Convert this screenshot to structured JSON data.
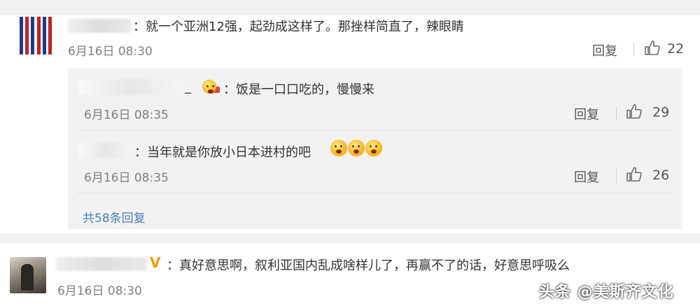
{
  "comments": [
    {
      "text": "：就一个亚洲12强，起劲成这样了。那挫样简直了，辣眼睛",
      "time": "6月16日 08:30",
      "reply_label": "回复",
      "likes": "22",
      "avatar_icon": "striped-flag-avatar-icon"
    },
    {
      "text": "：真好意思啊，叙利亚国内乱成啥样儿了，再赢不了的话，好意思呼吸么",
      "time": "6月16日 08:30",
      "avatar_icon": "photo-avatar-icon",
      "badge_icon": "v-verified-icon",
      "badge_text": "V"
    }
  ],
  "replies": [
    {
      "prefix": "_",
      "text": "：饭是一口口吃的，慢慢来",
      "time": "6月16日 08:35",
      "reply_label": "回复",
      "likes": "29",
      "badge_icon": "emoji-badge-icon"
    },
    {
      "text": "：当年就是你放小日本进村的吧",
      "emoji_icon": "scream-emoji-icon",
      "time": "6月16日 08:35",
      "reply_label": "回复",
      "likes": "26"
    }
  ],
  "more_replies": "共58条回复",
  "watermark": "头条 @美斯齐文化",
  "colors": {
    "link": "#4a7fb5",
    "time": "#808080",
    "reply_bg": "#f2f2f2",
    "vip_badge": "#f0a000"
  }
}
